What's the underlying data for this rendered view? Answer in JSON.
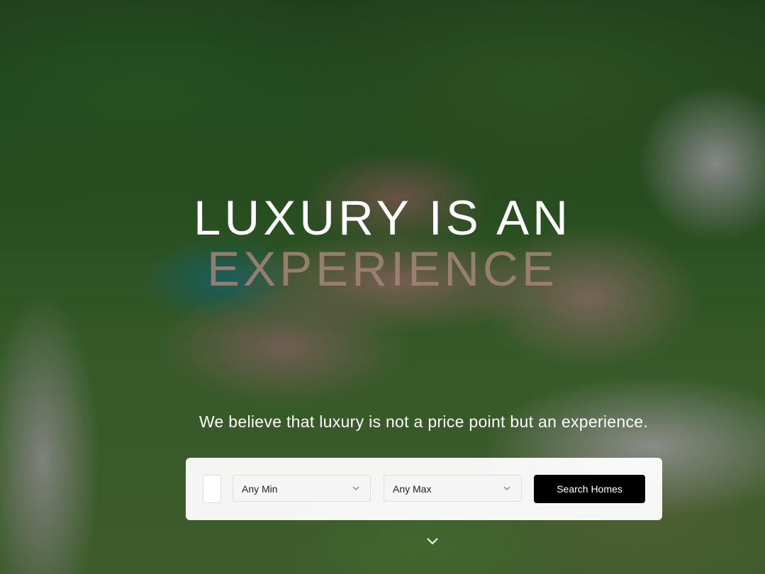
{
  "hero": {
    "headline_line1": "LUXURY IS AN",
    "headline_line2": "EXPERIENCE",
    "subtitle": "We believe that luxury is not a price point but an experience."
  },
  "search": {
    "location_value": "",
    "min_price": "Any Min",
    "max_price": "Any Max",
    "button_label": "Search Homes"
  },
  "icons": {
    "dropdown": "chevron-down-icon",
    "scroll": "chevron-down-icon"
  },
  "colors": {
    "headline_white": "#ffffff",
    "headline_accent": "#a38677",
    "button_bg": "#000000"
  }
}
